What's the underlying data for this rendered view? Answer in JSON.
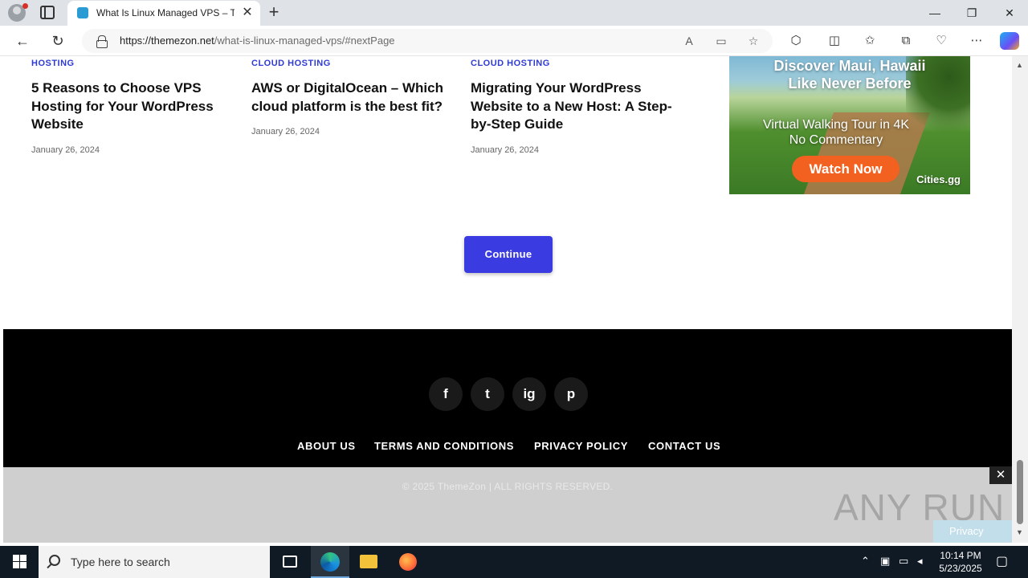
{
  "browser": {
    "tab_title": "What Is Linux Managed VPS – Th",
    "tab_close": "✕",
    "new_tab": "+",
    "url_host": "https://themezon.net",
    "url_path": "/what-is-linux-managed-vps/#nextPage",
    "window": {
      "minimize": "—",
      "restore": "❐",
      "close": "✕"
    }
  },
  "posts": [
    {
      "category": "HOSTING",
      "title": "5 Reasons to Choose VPS Hosting for Your WordPress Website",
      "date": "January 26, 2024"
    },
    {
      "category": "CLOUD HOSTING",
      "title": "AWS or DigitalOcean – Which cloud platform is the best fit?",
      "date": "January 26, 2024"
    },
    {
      "category": "CLOUD HOSTING",
      "title": "Migrating Your WordPress Website to a New Host: A Step-by-Step Guide",
      "date": "January 26, 2024"
    }
  ],
  "ad": {
    "line1": "Discover Maui, Hawaii",
    "line2": "Like Never Before",
    "line3": "Virtual Walking Tour in 4K",
    "line4": "No Commentary",
    "button": "Watch Now",
    "brand": "Cities.gg"
  },
  "continue_label": "Continue",
  "footer": {
    "social": [
      "f",
      "t",
      "ig",
      "p"
    ],
    "links": [
      "ABOUT US",
      "TERMS AND CONDITIONS",
      "PRIVACY POLICY",
      "CONTACT US"
    ],
    "copyright": "© 2025 ThemeZon | ALL RIGHTS RESERVED."
  },
  "overlay": {
    "close": "✕",
    "watermark": "ANY RUN",
    "privacy": "Privacy"
  },
  "taskbar": {
    "search_placeholder": "Type here to search",
    "time": "10:14 PM",
    "date": "5/23/2025"
  },
  "colors": {
    "accent": "#3a3be0",
    "category": "#2f3bd1",
    "footer_bg": "#000000"
  }
}
